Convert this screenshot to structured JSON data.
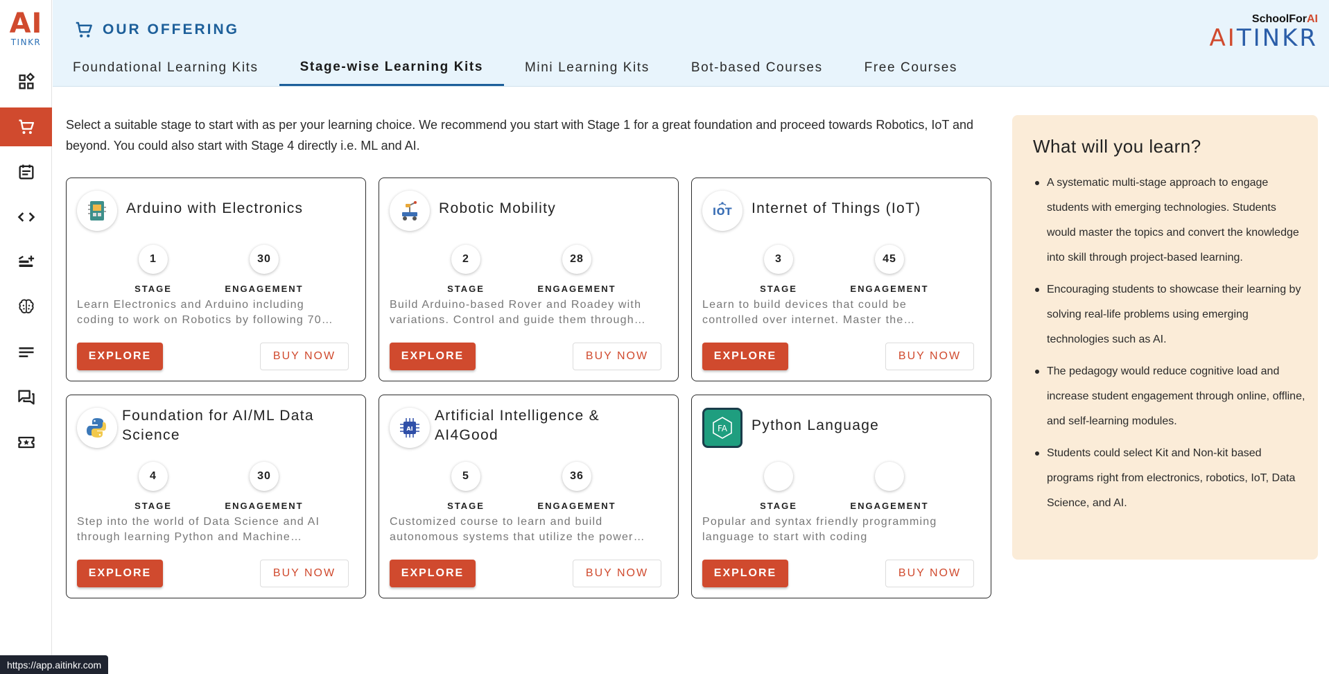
{
  "logo": {
    "mark": "AI",
    "text": "TINKR"
  },
  "header": {
    "title": "OUR OFFERING",
    "brand_small_prefix": "SchoolFor",
    "brand_small_suffix": "AI",
    "brand_main_prefix": "AI",
    "brand_main_suffix": "TINKR",
    "tabs": [
      {
        "label": "Foundational Learning Kits"
      },
      {
        "label": "Stage-wise Learning Kits"
      },
      {
        "label": "Mini Learning Kits"
      },
      {
        "label": "Bot-based Courses"
      },
      {
        "label": "Free Courses"
      }
    ]
  },
  "sidebar": {
    "items": [
      {
        "icon": "dashboard-icon"
      },
      {
        "icon": "cart-icon",
        "active": true
      },
      {
        "icon": "calendar-icon"
      },
      {
        "icon": "code-icon"
      },
      {
        "icon": "playlist-add-icon"
      },
      {
        "icon": "brain-icon"
      },
      {
        "icon": "notes-icon"
      },
      {
        "icon": "forum-icon"
      },
      {
        "icon": "ticket-star-icon"
      }
    ]
  },
  "intro": "Select a suitable stage to start with as per your learning choice. We recommend you start with Stage 1 for a great foundation and proceed towards Robotics, IoT and beyond. You could also start with Stage 4 directly i.e. ML and AI.",
  "labels": {
    "stage": "STAGE",
    "engagement": "ENGAGEMENT",
    "explore": "EXPLORE",
    "buy_now": "BUY NOW"
  },
  "cards": [
    {
      "title": "Arduino with Electronics",
      "stage": "1",
      "engagement": "30",
      "desc1": "Learn Electronics and Arduino including",
      "desc2": "coding to work on Robotics by following 70…"
    },
    {
      "title": "Robotic Mobility",
      "stage": "2",
      "engagement": "28",
      "desc1": "Build Arduino-based Rover and Roadey with",
      "desc2": "variations. Control and guide them through…"
    },
    {
      "title": "Internet of Things (IoT)",
      "stage": "3",
      "engagement": "45",
      "desc1": "Learn to build devices that could be",
      "desc2": "controlled over internet. Master the…"
    },
    {
      "title": "Foundation for AI/ML Data Science",
      "stage": "4",
      "engagement": "30",
      "desc1": "Step into the world of Data Science and AI",
      "desc2": "through learning Python and Machine…"
    },
    {
      "title": "Artificial Intelligence & AI4Good",
      "stage": "5",
      "engagement": "36",
      "desc1": "Customized course to learn and build",
      "desc2": "autonomous systems that utilize the power…"
    },
    {
      "title": "Python Language",
      "stage": "",
      "engagement": "",
      "desc1": "Popular and syntax friendly programming",
      "desc2": "language to start with coding"
    }
  ],
  "learn": {
    "heading": "What will you learn?",
    "points": [
      "A systematic multi-stage approach to engage students with emerging technologies. Students would master the topics and convert the knowledge into skill through project-based learning.",
      "Encouraging students to showcase their learning by solving real-life problems using emerging technologies such as AI.",
      "The pedagogy would reduce cognitive load and increase student engagement through online, offline, and self-learning modules.",
      "Students could select Kit and Non-kit based programs right from electronics, robotics, IoT, Data Science, and AI."
    ]
  },
  "status_url": "https://app.aitinkr.com",
  "colors": {
    "accent": "#d04a2e",
    "primary": "#1d5f9a",
    "header_bg": "#e8f4fc",
    "learn_bg": "#fbecd8"
  }
}
